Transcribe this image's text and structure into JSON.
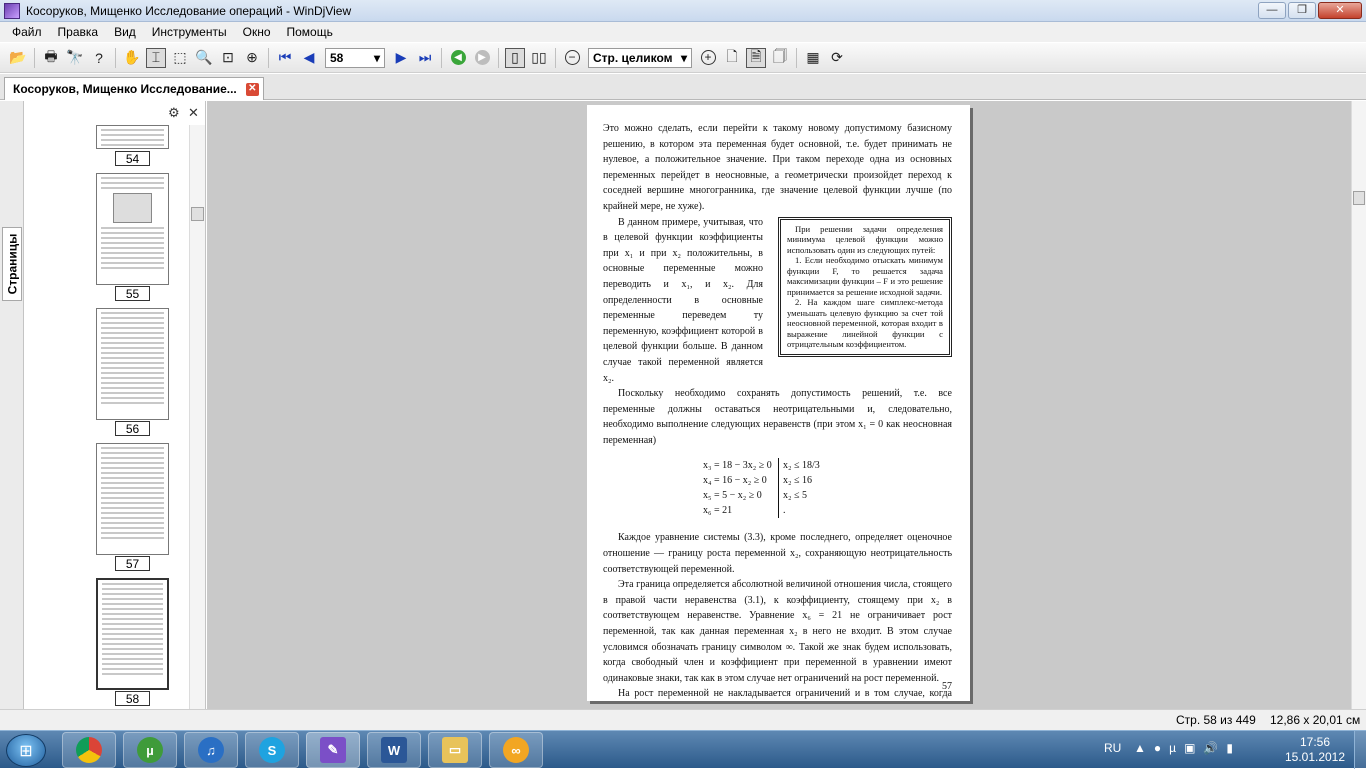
{
  "window": {
    "title": "Косоруков, Мищенко Исследование операций - WinDjView",
    "minimize": "—",
    "maximize": "❐",
    "close": "✕"
  },
  "menu": [
    "Файл",
    "Правка",
    "Вид",
    "Инструменты",
    "Окно",
    "Помощь"
  ],
  "toolbar": {
    "page_value": "58",
    "zoom_value": "Стр. целиком"
  },
  "tab": {
    "label": "Косоруков, Мищенко Исследование...",
    "close": "✕"
  },
  "sidebar": {
    "tab_label": "Страницы",
    "thumbnails": [
      "54",
      "55",
      "56",
      "57",
      "58"
    ]
  },
  "page": {
    "para1": "Это можно сделать, если перейти к такому новому допустимому базисному решению, в котором эта переменная будет основной, т.е. будет принимать не нулевое, а положительное значение. При таком переходе одна из основных переменных перейдет в неосновные, а геометрически произойдет переход к соседней вершине многогранника, где значение целевой функции лучше (по крайней мере, не хуже).",
    "para2": "В данном примере, учитывая, что в целевой функции коэффициенты при x₁ и при x₂ положительны, в основные переменные можно переводить и x₁, и x₂. Для определенности в основные переменные переведем ту переменную, коэффициент которой в целевой функции больше. В данном случае такой переменной является x₂.",
    "box_p1": "При решении задачи определения минимума целевой функции можно использовать один из следующих путей:",
    "box_p2": "1. Если необходимо отыскать минимум функции F, то решается задача максимизации функции – F и это решение принимается за решение исходной задачи.",
    "box_p3": "2. На каждом шаге симплекс-метода уменьшать целевую функцию за счет той неосновной переменной, которая входит в выражение линейной функции с отрицательным коэффициентом.",
    "para3": "Поскольку необходимо сохранять допустимость решений, т.е. все переменные должны оставаться неотрицательными и, следовательно, необходимо выполнение следующих неравенств (при этом x₁ = 0 как неосновная переменная)",
    "eq": [
      {
        "left": "x₃ = 18 − 3x₂ ≥ 0",
        "right": "x₂ ≤ 18/3"
      },
      {
        "left": "x₄ = 16 − x₂ ≥ 0",
        "right": "x₂ ≤ 16"
      },
      {
        "left": "x₅ = 5 − x₂ ≥ 0",
        "right": "x₂ ≤ 5"
      },
      {
        "left": "x₆ = 21",
        "right": "."
      }
    ],
    "para4": "Каждое уравнение системы (3.3), кроме последнего, определяет оценочное отношение — границу роста переменной x₂, сохраняющую неотрицательность соответствующей переменной.",
    "para5": "Эта граница определяется абсолютной величиной отношения числа, стоящего в правой части неравенства (3.1), к коэффициенту, стоящему при x₂ в соответствующем неравенстве. Уравнение x₆ = 21 не ограничивает рост переменной, так как данная переменная x₂ в него не входит. В этом случае условимся обозначать границу символом ∞. Такой же знак будем использовать, когда свободный член и коэффициент при переменной в уравнении имеют одинаковые знаки, так как в этом случае нет ограничений на рост переменной.",
    "para6": "На рост переменной не накладывается ограничений и в том случае, когда правая часть соответствующего неравенства равна нулю, а перево-",
    "number": "57"
  },
  "status": {
    "page": "Стр. 58 из 449",
    "size": "12,86 x 20,01 см"
  },
  "taskbar": {
    "lang": "RU",
    "time": "17:56",
    "date": "15.01.2012"
  }
}
